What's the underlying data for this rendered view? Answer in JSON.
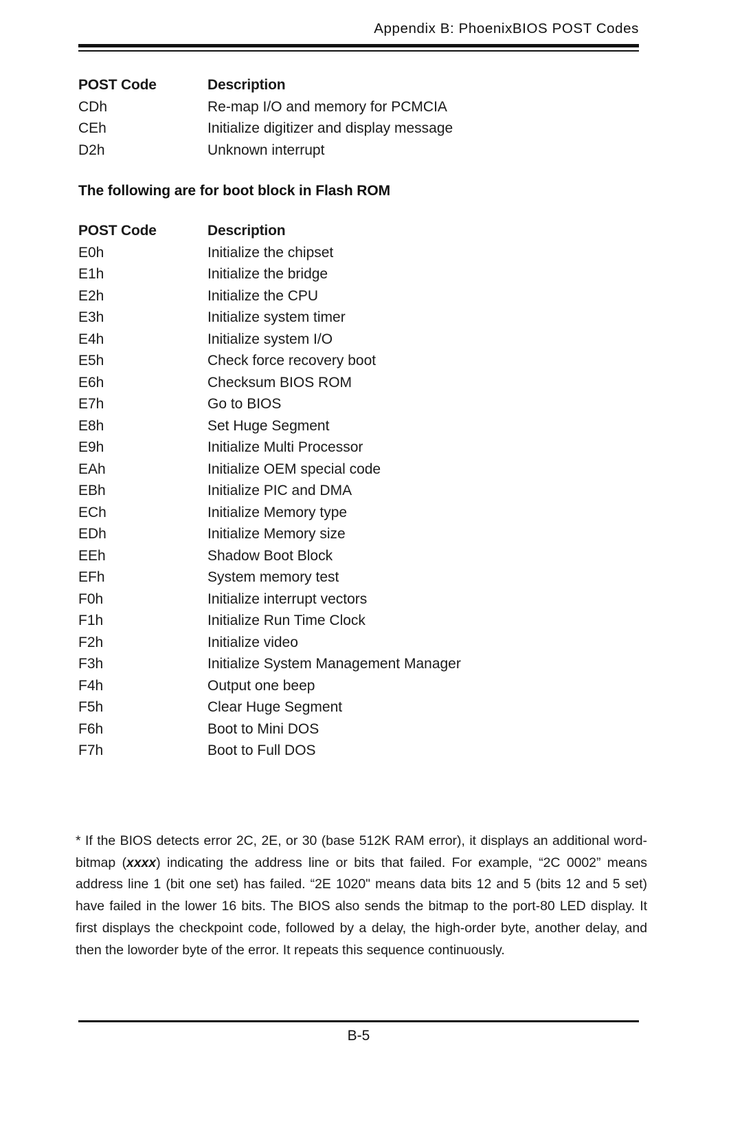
{
  "header": {
    "running_head": "Appendix B: PhoenixBIOS POST Codes"
  },
  "table_one": {
    "headers": {
      "code": "POST Code",
      "description": "Description"
    },
    "rows": [
      {
        "code": "CDh",
        "description": "Re-map I/O and memory for PCMCIA"
      },
      {
        "code": "CEh",
        "description": "Initialize digitizer and display message"
      },
      {
        "code": "D2h",
        "description": "Unknown interrupt"
      }
    ]
  },
  "section_heading": "The following are for boot block in Flash ROM",
  "table_two": {
    "headers": {
      "code": "POST Code",
      "description": "Description"
    },
    "rows": [
      {
        "code": "E0h",
        "description": "Initialize the chipset"
      },
      {
        "code": "E1h",
        "description": "Initialize the bridge"
      },
      {
        "code": "E2h",
        "description": "Initialize the CPU"
      },
      {
        "code": "E3h",
        "description": "Initialize system timer"
      },
      {
        "code": "E4h",
        "description": "Initialize system I/O"
      },
      {
        "code": "E5h",
        "description": "Check force recovery boot"
      },
      {
        "code": "E6h",
        "description": "Checksum BIOS ROM"
      },
      {
        "code": "E7h",
        "description": "Go to BIOS"
      },
      {
        "code": "E8h",
        "description": "Set Huge Segment"
      },
      {
        "code": "E9h",
        "description": "Initialize Multi Processor"
      },
      {
        "code": "EAh",
        "description": "Initialize OEM special code"
      },
      {
        "code": "EBh",
        "description": "Initialize PIC and DMA"
      },
      {
        "code": "ECh",
        "description": "Initialize Memory type"
      },
      {
        "code": "EDh",
        "description": "Initialize Memory size"
      },
      {
        "code": "EEh",
        "description": "Shadow Boot Block"
      },
      {
        "code": "EFh",
        "description": "System memory test"
      },
      {
        "code": "F0h",
        "description": "Initialize interrupt vectors"
      },
      {
        "code": "F1h",
        "description": "Initialize Run Time Clock"
      },
      {
        "code": "F2h",
        "description": "Initialize video"
      },
      {
        "code": "F3h",
        "description": "Initialize System Management Manager"
      },
      {
        "code": "F4h",
        "description": "Output one beep"
      },
      {
        "code": "F5h",
        "description": "Clear Huge Segment"
      },
      {
        "code": "F6h",
        "description": "Boot to Mini DOS"
      },
      {
        "code": "F7h",
        "description": "Boot to Full DOS"
      }
    ]
  },
  "footnote": {
    "part_1": "* If the BIOS detects error 2C, 2E, or 30 (base 512K RAM error), it displays an additional word-bitmap (",
    "emphasis": "xxxx",
    "part_2": ") indicating the address line or bits that failed.  For example, “2C 0002” means address line 1 (bit one set) has failed.  “2E 1020\" means data bits 12 and 5 (bits 12 and 5 set) have failed in the lower 16 bits.  The BIOS also sends the bitmap to the port-80 LED display.  It first displays the checkpoint code, followed by a delay, the high-order byte, another delay, and then the loworder byte of the error.  It repeats this sequence continuously."
  },
  "footer": {
    "page_number": "B-5"
  }
}
